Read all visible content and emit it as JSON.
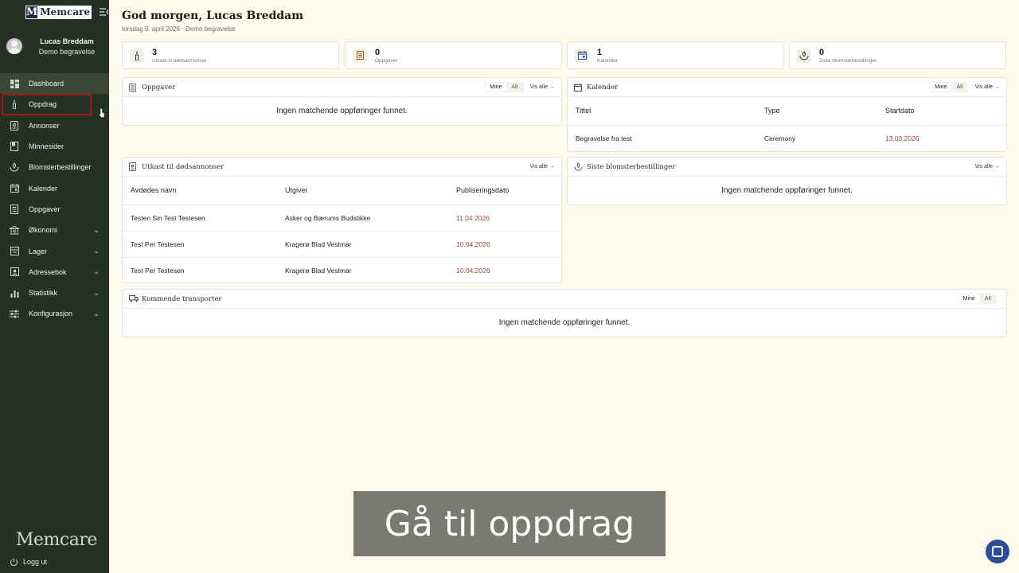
{
  "brand": {
    "mark": "M",
    "wordmark": "Memcare",
    "footer_wordmark": "Memcare"
  },
  "profile": {
    "name": "Lucas Breddam",
    "org": "Demo begravelse"
  },
  "nav": [
    {
      "label": "Dashboard",
      "icon": "dashboard-icon"
    },
    {
      "label": "Oppdrag",
      "icon": "candle-icon"
    },
    {
      "label": "Annonser",
      "icon": "document-icon"
    },
    {
      "label": "Minnesider",
      "icon": "book-icon"
    },
    {
      "label": "Blomsterbestillinger",
      "icon": "flower-icon"
    },
    {
      "label": "Kalender",
      "icon": "calendar-icon"
    },
    {
      "label": "Oppgaver",
      "icon": "list-icon"
    },
    {
      "label": "Økonomi",
      "icon": "bank-icon"
    },
    {
      "label": "Lager",
      "icon": "box-icon"
    },
    {
      "label": "Adressebok",
      "icon": "contacts-icon"
    },
    {
      "label": "Statistikk",
      "icon": "bar-chart-icon"
    },
    {
      "label": "Konfigurasjon",
      "icon": "sliders-icon"
    }
  ],
  "logout": "Logg ut",
  "header": {
    "greeting": "God morgen, Lucas Breddam",
    "subline": "torsdag 9. april 2026 · Demo begravelse"
  },
  "stats": [
    {
      "value": "3",
      "label": "Utkast til dødsannonser"
    },
    {
      "value": "0",
      "label": "Oppgaver"
    },
    {
      "value": "1",
      "label": "Kalender"
    },
    {
      "value": "0",
      "label": "Siste blomsterbestillinger"
    }
  ],
  "seg": {
    "mine": "Mine",
    "alt": "Alt"
  },
  "see_all": "Vis alle →",
  "empty": "Ingen matchende oppføringer funnet.",
  "tasks": {
    "title": "Oppgaver"
  },
  "calendar": {
    "title": "Kalender",
    "columns": [
      "Tittel",
      "Type",
      "Startdato"
    ],
    "rows": [
      [
        "Begravelse fra test",
        "Ceremony",
        "13.03.2026"
      ]
    ]
  },
  "drafts": {
    "title": "Utkast til dødsannonser",
    "columns": [
      "Avdødes navn",
      "Utgiver",
      "Publiseringsdato"
    ],
    "rows": [
      [
        "Testen Sin Test Testesen",
        "Asker og Bærums Budstikke",
        "11.04.2026"
      ],
      [
        "Test Per Testesen",
        "Kragerø Blad Vestmar",
        "10.04.2026"
      ],
      [
        "Test Per Testesen",
        "Kragerø Blad Vestmar",
        "10.04.2026"
      ]
    ]
  },
  "flowers": {
    "title": "Siste blomsterbestillinger"
  },
  "transports": {
    "title": "Kommende transporter"
  },
  "caption": "Gå til oppdrag"
}
